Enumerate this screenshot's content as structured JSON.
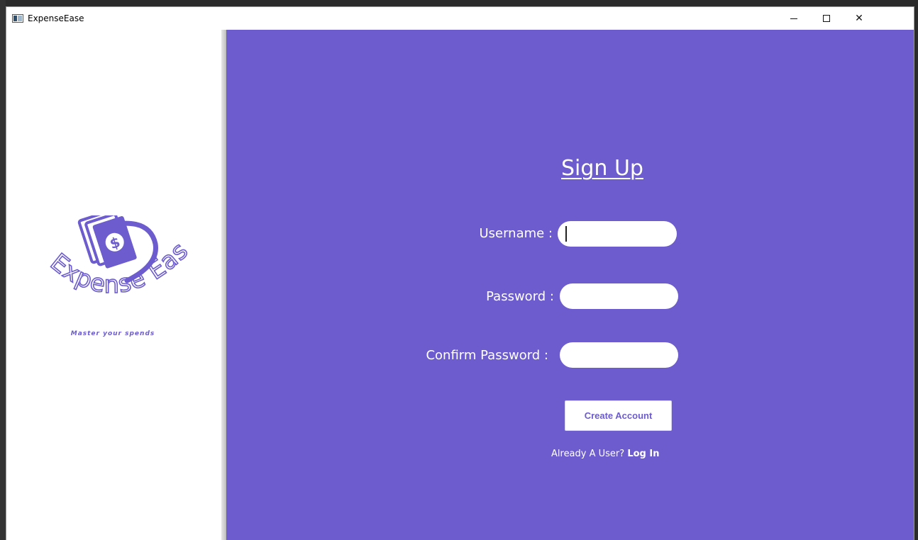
{
  "window": {
    "title": "ExpenseEase",
    "minimize_icon": "minimize-icon",
    "maximize_icon": "maximize-icon",
    "close_icon": "close-icon"
  },
  "brand": {
    "logo_text": "Expense Ease",
    "tagline": "Master your spends",
    "color": "#6c5ccd"
  },
  "form": {
    "heading": "Sign Up",
    "username_label": "Username :",
    "username_value": "",
    "password_label": "Password :",
    "password_value": "",
    "confirm_label": "Confirm Password :",
    "confirm_value": "",
    "submit_label": "Create Account",
    "already_user_text": "Already A User?",
    "login_link": "Log In"
  },
  "colors": {
    "panel_bg": "#6c5ccd",
    "field_bg": "#ffffff",
    "text_on_panel": "#ffffff"
  }
}
